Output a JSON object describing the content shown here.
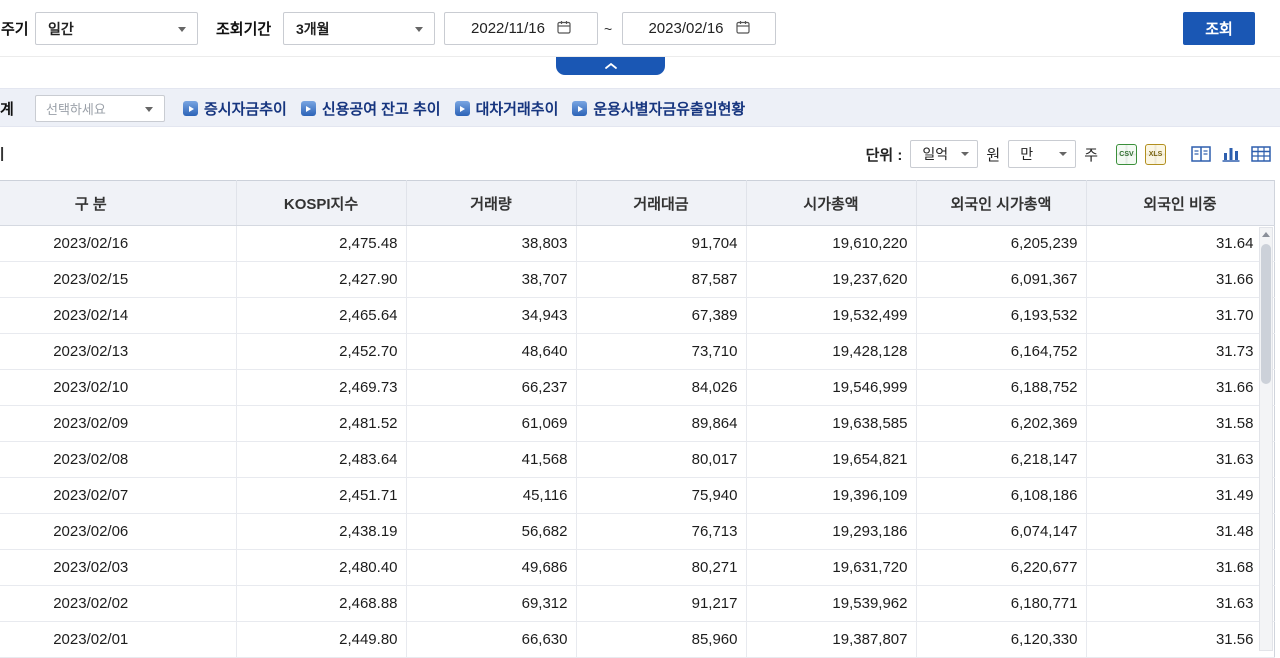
{
  "colors": {
    "accent_blue": "#1a57b4",
    "link_navy": "#16357f",
    "related_bar_bg": "#edf0f7",
    "table_header_bg": "#f0f2f7"
  },
  "filter_bar": {
    "period_label": "주기",
    "period_value": "일간",
    "range_label": "조회기간",
    "range_value": "3개월",
    "date_from": "2022/11/16",
    "tilde": "~",
    "date_to": "2023/02/16",
    "search_label": "조회"
  },
  "related_bar": {
    "label": "계",
    "select_placeholder": "선택하세요",
    "links": [
      "증시자금추이",
      "신용공여 잔고 추이",
      "대차거래추이",
      "운용사별자금유출입현황"
    ]
  },
  "page_fragment": "|",
  "toolbar": {
    "unit_label": "단위 :",
    "amount_unit": "일억",
    "amount_suffix": "원",
    "volume_unit": "만",
    "volume_suffix": "주",
    "csv_label": "CSV",
    "xls_label": "XLS"
  },
  "icons": {
    "calendar": "calendar-icon",
    "dropdown": "chevron-down-icon",
    "collapse": "chevron-up-icon",
    "link_bullet": "play-icon",
    "export": [
      "csv-file-icon",
      "xls-file-icon"
    ],
    "view_toggles": [
      "split-view-icon",
      "bar-chart-icon",
      "table-view-icon"
    ]
  },
  "table": {
    "headers": [
      "구 분",
      "KOSPI지수",
      "거래량",
      "거래대금",
      "시가총액",
      "외국인 시가총액",
      "외국인 비중"
    ],
    "rows": [
      [
        "2023/02/16",
        "2,475.48",
        "38,803",
        "91,704",
        "19,610,220",
        "6,205,239",
        "31.64"
      ],
      [
        "2023/02/15",
        "2,427.90",
        "38,707",
        "87,587",
        "19,237,620",
        "6,091,367",
        "31.66"
      ],
      [
        "2023/02/14",
        "2,465.64",
        "34,943",
        "67,389",
        "19,532,499",
        "6,193,532",
        "31.70"
      ],
      [
        "2023/02/13",
        "2,452.70",
        "48,640",
        "73,710",
        "19,428,128",
        "6,164,752",
        "31.73"
      ],
      [
        "2023/02/10",
        "2,469.73",
        "66,237",
        "84,026",
        "19,546,999",
        "6,188,752",
        "31.66"
      ],
      [
        "2023/02/09",
        "2,481.52",
        "61,069",
        "89,864",
        "19,638,585",
        "6,202,369",
        "31.58"
      ],
      [
        "2023/02/08",
        "2,483.64",
        "41,568",
        "80,017",
        "19,654,821",
        "6,218,147",
        "31.63"
      ],
      [
        "2023/02/07",
        "2,451.71",
        "45,116",
        "75,940",
        "19,396,109",
        "6,108,186",
        "31.49"
      ],
      [
        "2023/02/06",
        "2,438.19",
        "56,682",
        "76,713",
        "19,293,186",
        "6,074,147",
        "31.48"
      ],
      [
        "2023/02/03",
        "2,480.40",
        "49,686",
        "80,271",
        "19,631,720",
        "6,220,677",
        "31.68"
      ],
      [
        "2023/02/02",
        "2,468.88",
        "69,312",
        "91,217",
        "19,539,962",
        "6,180,771",
        "31.63"
      ],
      [
        "2023/02/01",
        "2,449.80",
        "66,630",
        "85,960",
        "19,387,807",
        "6,120,330",
        "31.56"
      ]
    ]
  }
}
